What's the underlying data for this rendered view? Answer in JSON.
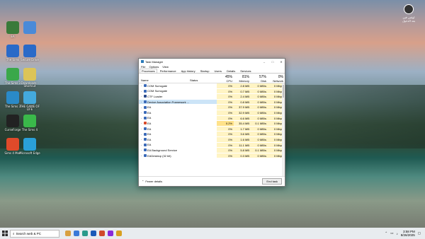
{
  "desktop": {
    "icons": [
      {
        "label": "EA",
        "color": "#3a7a3a"
      },
      {
        "label": "",
        "color": "#4a8ad8"
      },
      {
        "label": "The Sims",
        "color": "#2a6ac8"
      },
      {
        "label": "Secure Drive",
        "color": "#2a6ac8"
      },
      {
        "label": "The Sims 3",
        "color": "#3aa84a"
      },
      {
        "label": "Downloads - Shortcut",
        "color": "#dcc458"
      },
      {
        "label": "The Sims 3",
        "color": "#2a8ac8"
      },
      {
        "label": "THE GAME OF LIFE",
        "color": "#44aadd"
      },
      {
        "label": "CurseForge",
        "color": "#222222"
      },
      {
        "label": "The Sims 4",
        "color": "#3ab84a"
      },
      {
        "label": "Sims 4 Mod",
        "color": "#e04a2a"
      },
      {
        "label": "Microsoft Edge",
        "color": "#2aa0d8"
      }
    ],
    "user": {
      "name": "لوئس فين",
      "sub": "بعد الدخول"
    }
  },
  "task_manager": {
    "title": "Task Manager",
    "window_buttons": [
      "–",
      "□",
      "✕"
    ],
    "menu": [
      "File",
      "Options",
      "View"
    ],
    "tabs": [
      "Processes",
      "Performance",
      "App history",
      "Startup",
      "Users",
      "Details",
      "Services"
    ],
    "active_tab": "Processes",
    "columns": {
      "name": "Name",
      "status": "Status",
      "cpu_pct": "45%",
      "cpu": "CPU",
      "mem_pct": "81%",
      "mem": "Memory",
      "disk_pct": "57%",
      "disk": "Disk",
      "net_pct": "0%",
      "net": "Network"
    },
    "rows": [
      {
        "name": "COM Surrogate",
        "cpu": "0%",
        "mem": "2.8 MB",
        "disk": "0 MB/s",
        "net": "0 Mbps",
        "icon": "#3a6ab8"
      },
      {
        "name": "COM Surrogate",
        "cpu": "0%",
        "mem": "0.7 MB",
        "disk": "0 MB/s",
        "net": "0 Mbps",
        "icon": "#3a6ab8"
      },
      {
        "name": "CTF Loader",
        "cpu": "0%",
        "mem": "2.4 MB",
        "disk": "0 MB/s",
        "net": "0 Mbps",
        "icon": "#2a4a8a"
      },
      {
        "name": "Device Association Framework ...",
        "cpu": "0%",
        "mem": "0.8 MB",
        "disk": "0 MB/s",
        "net": "0 Mbps",
        "icon": "#3a6ab8"
      },
      {
        "name": "EA",
        "cpu": "0%",
        "mem": "37.9 MB",
        "disk": "0 MB/s",
        "net": "0 Mbps",
        "icon": "#3a6ab8"
      },
      {
        "name": "EA",
        "cpu": "0%",
        "mem": "32.9 MB",
        "disk": "0 MB/s",
        "net": "0 Mbps",
        "icon": "#3a6ab8"
      },
      {
        "name": "EA",
        "cpu": "0%",
        "mem": "6.6 MB",
        "disk": "0 MB/s",
        "net": "0 Mbps",
        "icon": "#3a6ab8"
      },
      {
        "name": "EA",
        "cpu": "0.2%",
        "mem": "35.4 MB",
        "disk": "0.1 MB/s",
        "net": "0 Mbps",
        "icon": "#d84a2a"
      },
      {
        "name": "EA",
        "cpu": "0%",
        "mem": "1.7 MB",
        "disk": "0 MB/s",
        "net": "0 Mbps",
        "icon": "#3a6ab8"
      },
      {
        "name": "EA",
        "cpu": "0%",
        "mem": "3.6 MB",
        "disk": "0 MB/s",
        "net": "0 Mbps",
        "icon": "#3a6ab8"
      },
      {
        "name": "EA",
        "cpu": "0%",
        "mem": "1.6 MB",
        "disk": "0 MB/s",
        "net": "0 Mbps",
        "icon": "#3a6ab8"
      },
      {
        "name": "EA",
        "cpu": "0%",
        "mem": "11.1 MB",
        "disk": "0 MB/s",
        "net": "0 Mbps",
        "icon": "#3a6ab8"
      },
      {
        "name": "EA Background Service",
        "cpu": "0%",
        "mem": "5.8 MB",
        "disk": "0.1 MB/s",
        "net": "0 Mbps",
        "icon": "#3a6ab8"
      },
      {
        "name": "EADesktop (32 bit)",
        "cpu": "0%",
        "mem": "0.3 MB",
        "disk": "0 MB/s",
        "net": "0 Mbps",
        "icon": "#3a6ab8"
      }
    ],
    "footer": {
      "fewer_details": "Fewer details",
      "end_task": "End task"
    }
  },
  "taskbar": {
    "search_placeholder": "Search web & PC",
    "time": "3:58 PM",
    "date": "8/26/2025",
    "pinned": [
      "#d8a040",
      "#3a7ad8",
      "#2a9a8a",
      "#1a5ab8",
      "#d04a2a",
      "#8a2ad8",
      "#d8a020"
    ]
  }
}
